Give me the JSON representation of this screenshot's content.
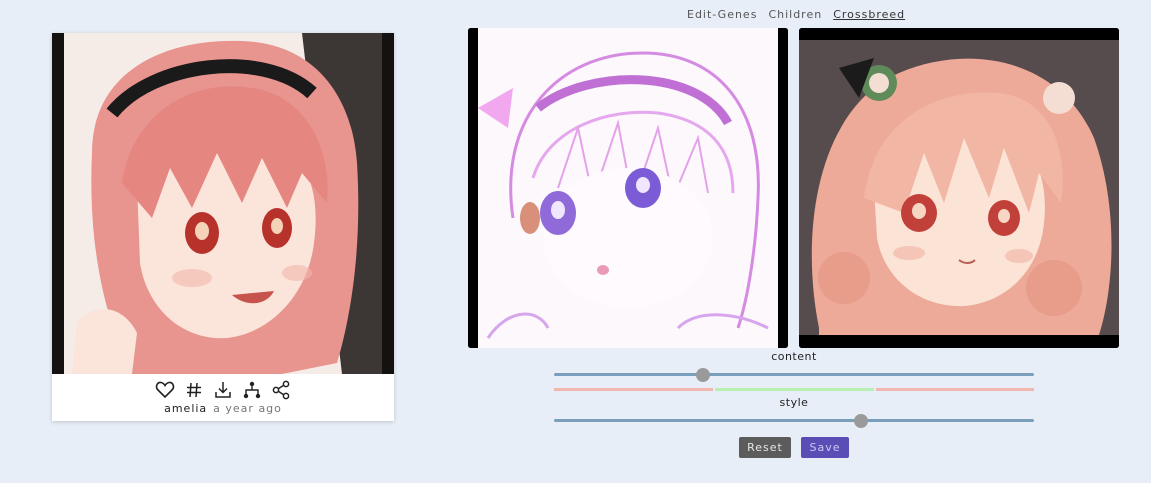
{
  "nav": {
    "tabs": [
      {
        "label": "Edit-Genes",
        "active": false
      },
      {
        "label": "Children",
        "active": false
      },
      {
        "label": "Crossbreed",
        "active": true
      }
    ]
  },
  "card": {
    "image_description": "anime girl with pink bob haircut and black headband, smiling",
    "actions": [
      {
        "icon": "heart-icon"
      },
      {
        "icon": "hashtag-icon"
      },
      {
        "icon": "download-icon"
      },
      {
        "icon": "family-tree-icon"
      },
      {
        "icon": "share-icon"
      }
    ],
    "author": "amelia",
    "time": "a year ago"
  },
  "parents": [
    {
      "name": "parent-a",
      "description": "pale white-haired anime girl with purple headband sketch"
    },
    {
      "name": "parent-b",
      "description": "anime girl with long peach wavy hair and hair ornaments"
    }
  ],
  "sliders": {
    "content": {
      "label": "content",
      "value": 0.31
    },
    "style": {
      "label": "style",
      "value": 0.64
    }
  },
  "mix_bar": {
    "segments": [
      {
        "color": "#f2b6b0",
        "fraction": 0.333
      },
      {
        "color": "#b8efb2",
        "fraction": 0.334
      },
      {
        "color": "#f2b6b0",
        "fraction": 0.333
      }
    ]
  },
  "buttons": {
    "reset_label": "Reset",
    "save_label": "Save"
  },
  "colors": {
    "background": "#e8eef7",
    "track": "#7a9fbd",
    "knob": "#9a9a9a",
    "reset_bg": "#5c5c5c",
    "save_bg": "#5a4db5"
  }
}
